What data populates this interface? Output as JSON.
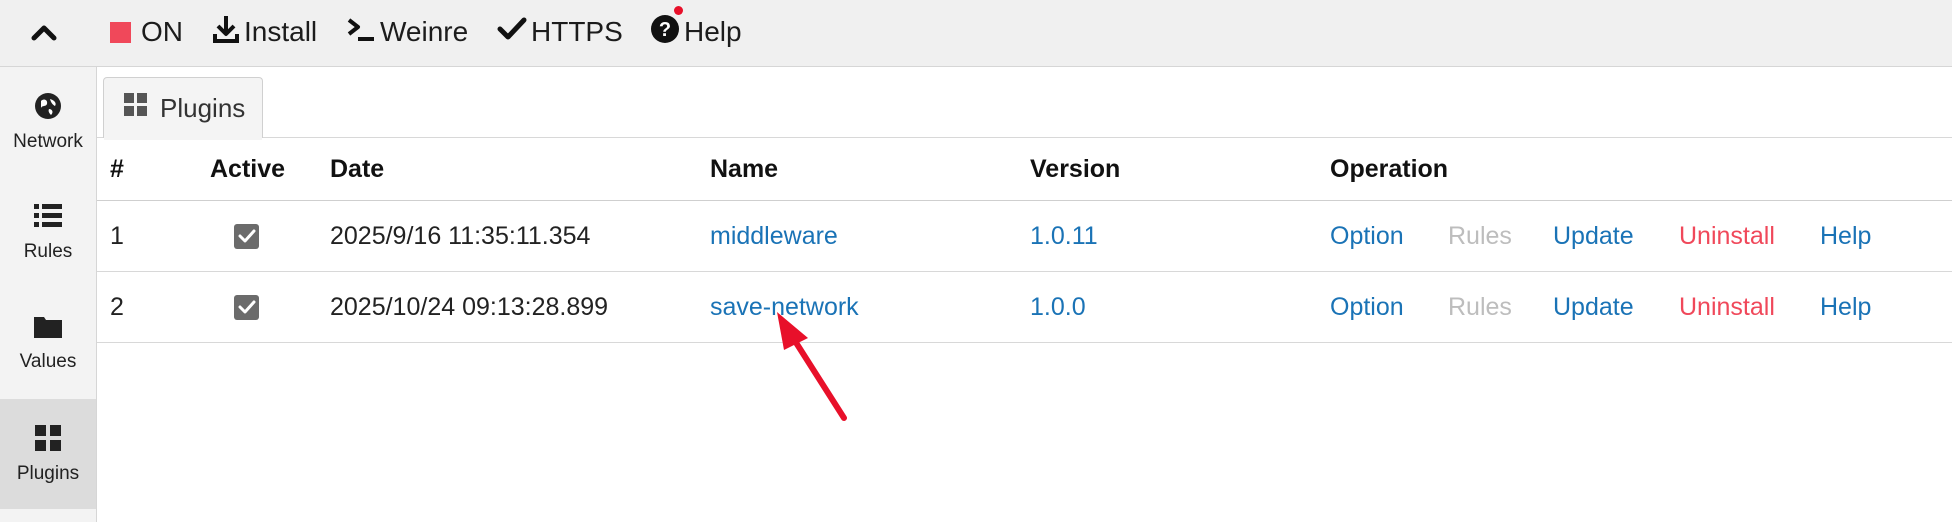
{
  "toolbar": {
    "on_label": "ON",
    "install_label": "Install",
    "weinre_label": "Weinre",
    "https_label": "HTTPS",
    "help_label": "Help"
  },
  "sidebar": {
    "items": [
      {
        "label": "Network",
        "icon": "globe-icon"
      },
      {
        "label": "Rules",
        "icon": "list-icon"
      },
      {
        "label": "Values",
        "icon": "folder-icon"
      },
      {
        "label": "Plugins",
        "icon": "grid-icon"
      }
    ]
  },
  "tab": {
    "label": "Plugins"
  },
  "table": {
    "headers": [
      "#",
      "Active",
      "Date",
      "Name",
      "Version",
      "Operation"
    ],
    "rows": [
      {
        "index": "1",
        "active": true,
        "date": "2025/9/16 11:35:11.354",
        "name": "middleware",
        "version": "1.0.11",
        "ops": [
          "Option",
          "Rules",
          "Update",
          "Uninstall",
          "Help"
        ]
      },
      {
        "index": "2",
        "active": true,
        "date": "2025/10/24 09:13:28.899",
        "name": "save-network",
        "version": "1.0.0",
        "ops": [
          "Option",
          "Rules",
          "Update",
          "Uninstall",
          "Help"
        ]
      }
    ]
  },
  "colors": {
    "link": "#1a73b6",
    "danger": "#f0485a",
    "disabled": "#bdbdbd",
    "on_indicator": "#f0485a",
    "notification_dot": "#e8102a",
    "annotation_arrow": "#e8102a"
  }
}
